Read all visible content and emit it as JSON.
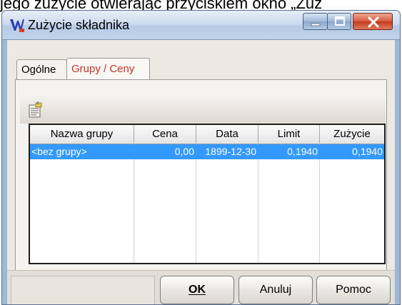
{
  "document": {
    "caption_fragment": "jego zużycie otwierając przyciskiem  okno „Zuż"
  },
  "window": {
    "title": "Zużycie składnika",
    "app_icon": "wapro-w-icon"
  },
  "tabs": [
    {
      "label": "Ogólne",
      "active": false
    },
    {
      "label": "Grupy / Ceny",
      "active": true
    }
  ],
  "toolbar": {
    "edit_icon": "edit-form-icon"
  },
  "table": {
    "columns": [
      "Nazwa grupy",
      "Cena",
      "Data",
      "Limit",
      "Zużycie"
    ],
    "rows": [
      {
        "group": "<bez grupy>",
        "price": "0,00",
        "date": "1899-12-30",
        "limit": "0,1940",
        "usage": "0,1940",
        "selected": true
      }
    ]
  },
  "buttons": {
    "ok_label": "OK",
    "cancel_label": "Anuluj",
    "help_label": "Pomoc"
  },
  "colors": {
    "selection": "#3399ff",
    "active_tab_text": "#c8302a",
    "close_button": "#c23b1c"
  }
}
